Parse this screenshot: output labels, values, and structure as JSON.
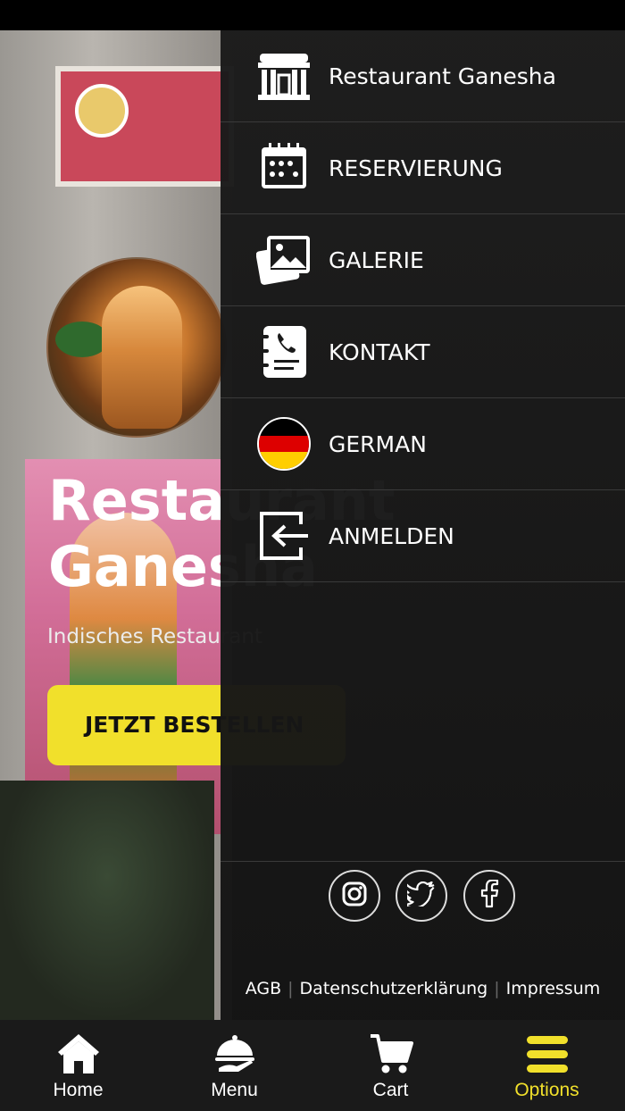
{
  "hero": {
    "title": "Restaurant\nGanesha",
    "subtitle": "Indisches Restaurant",
    "order_button": "JETZT BESTELLEN"
  },
  "drawer": {
    "items": [
      {
        "label": "Restaurant Ganesha",
        "icon": "restaurant-icon"
      },
      {
        "label": "RESERVIERUNG",
        "icon": "calendar-icon"
      },
      {
        "label": "GALERIE",
        "icon": "gallery-icon"
      },
      {
        "label": "KONTAKT",
        "icon": "contact-icon"
      },
      {
        "label": "GERMAN",
        "icon": "german-flag-icon"
      },
      {
        "label": "ANMELDEN",
        "icon": "login-icon"
      }
    ],
    "social": [
      "instagram-icon",
      "twitter-icon",
      "facebook-icon"
    ],
    "legal": {
      "agb": "AGB",
      "privacy": "Datenschutzerklärung",
      "imprint": "Impressum"
    }
  },
  "bottom_nav": {
    "items": [
      {
        "label": "Home",
        "icon": "home-icon"
      },
      {
        "label": "Menu",
        "icon": "cloche-icon"
      },
      {
        "label": "Cart",
        "icon": "cart-icon"
      },
      {
        "label": "Options",
        "icon": "options-icon",
        "active": true
      }
    ]
  },
  "colors": {
    "accent": "#f1e02b",
    "drawer_bg": "#1a1a1a",
    "nav_bg": "#1a1a1a"
  }
}
